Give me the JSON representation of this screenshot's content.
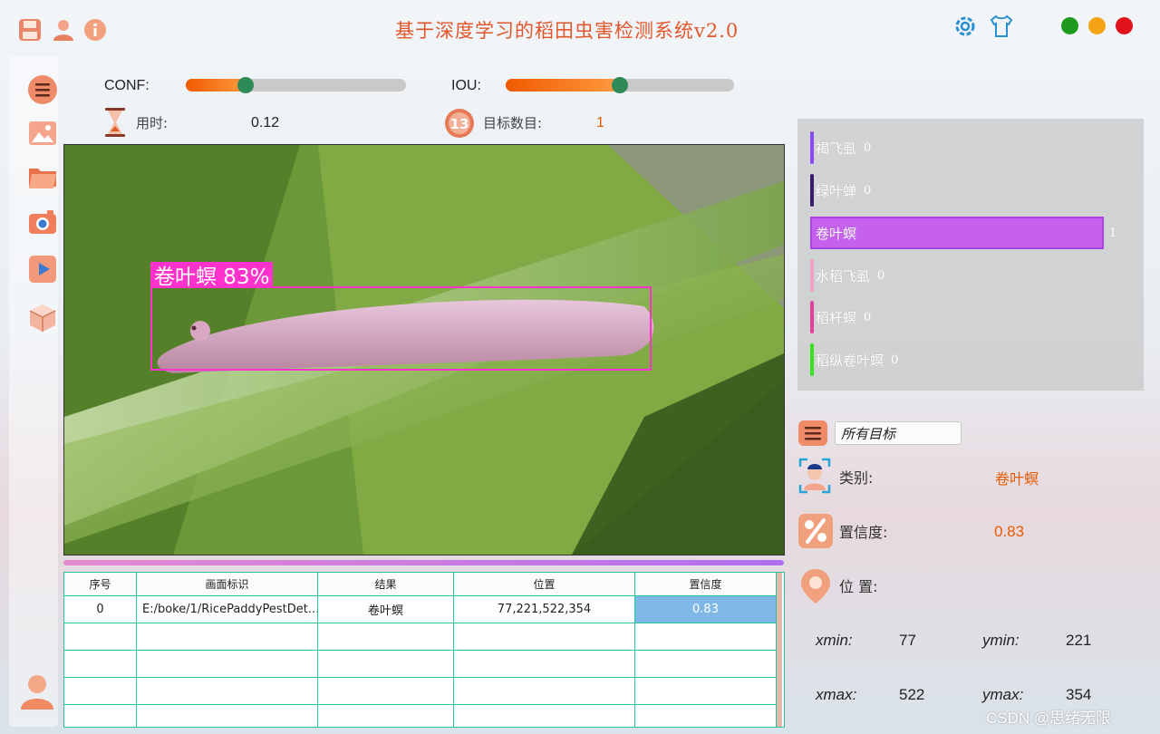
{
  "app": {
    "title": "基于深度学习的稻田虫害检测系统v2.0",
    "colors": {
      "accent": "#e2572a",
      "win_close": "#e0121b",
      "win_min": "#f3a314",
      "win_max": "#1e9b1e"
    }
  },
  "titlebar": {
    "left_icons": [
      "save-icon",
      "user-icon",
      "info-icon"
    ],
    "right_icons": [
      "settings-icon",
      "skin-icon"
    ]
  },
  "sidebar": {
    "items": [
      "menu-icon",
      "image-icon",
      "folder-icon",
      "camera-icon",
      "video-icon",
      "model-icon"
    ],
    "bottom": "user-icon"
  },
  "controls": {
    "conf_label": "CONF:",
    "conf_value": 0.27,
    "iou_label": "IOU:",
    "iou_value": 0.5,
    "time_label": "用时:",
    "time_value": "0.12",
    "count_label": "目标数目:",
    "count_value": "1"
  },
  "detection": {
    "label_text": "卷叶螟 83%",
    "box_color": "#ff33cc"
  },
  "table": {
    "headers": [
      "序号",
      "画面标识",
      "结果",
      "位置",
      "置信度"
    ],
    "rows": [
      [
        "0",
        "E:/boke/1/RicePaddyPestDet...",
        "卷叶螟",
        "77,221,522,354",
        "0.83"
      ]
    ]
  },
  "stats": {
    "items": [
      {
        "name": "褐飞虱",
        "count": "0",
        "color": "#8a4cf0",
        "value": 0
      },
      {
        "name": "绿叶蝉",
        "count": "0",
        "color": "#3a1a6a",
        "value": 0
      },
      {
        "name": "卷叶螟",
        "count": "1",
        "color": "#c65cf0",
        "value": 1
      },
      {
        "name": "水稻飞虱",
        "count": "0",
        "color": "#f0a0c0",
        "value": 0
      },
      {
        "name": "稻杆螟",
        "count": "0",
        "color": "#e040a0",
        "value": 0
      },
      {
        "name": "稻纵卷叶螟",
        "count": "0",
        "color": "#39e022",
        "value": 0
      }
    ]
  },
  "details": {
    "target_select": "所有目标",
    "class_label": "类别:",
    "class_value": "卷叶螟",
    "conf_label": "置信度:",
    "conf_value": "0.83",
    "pos_label": "位 置:",
    "xmin_label": "xmin:",
    "xmin_value": "77",
    "ymin_label": "ymin:",
    "ymin_value": "221",
    "xmax_label": "xmax:",
    "xmax_value": "522",
    "ymax_label": "ymax:",
    "ymax_value": "354"
  },
  "watermark": "CSDN @思绪无限"
}
